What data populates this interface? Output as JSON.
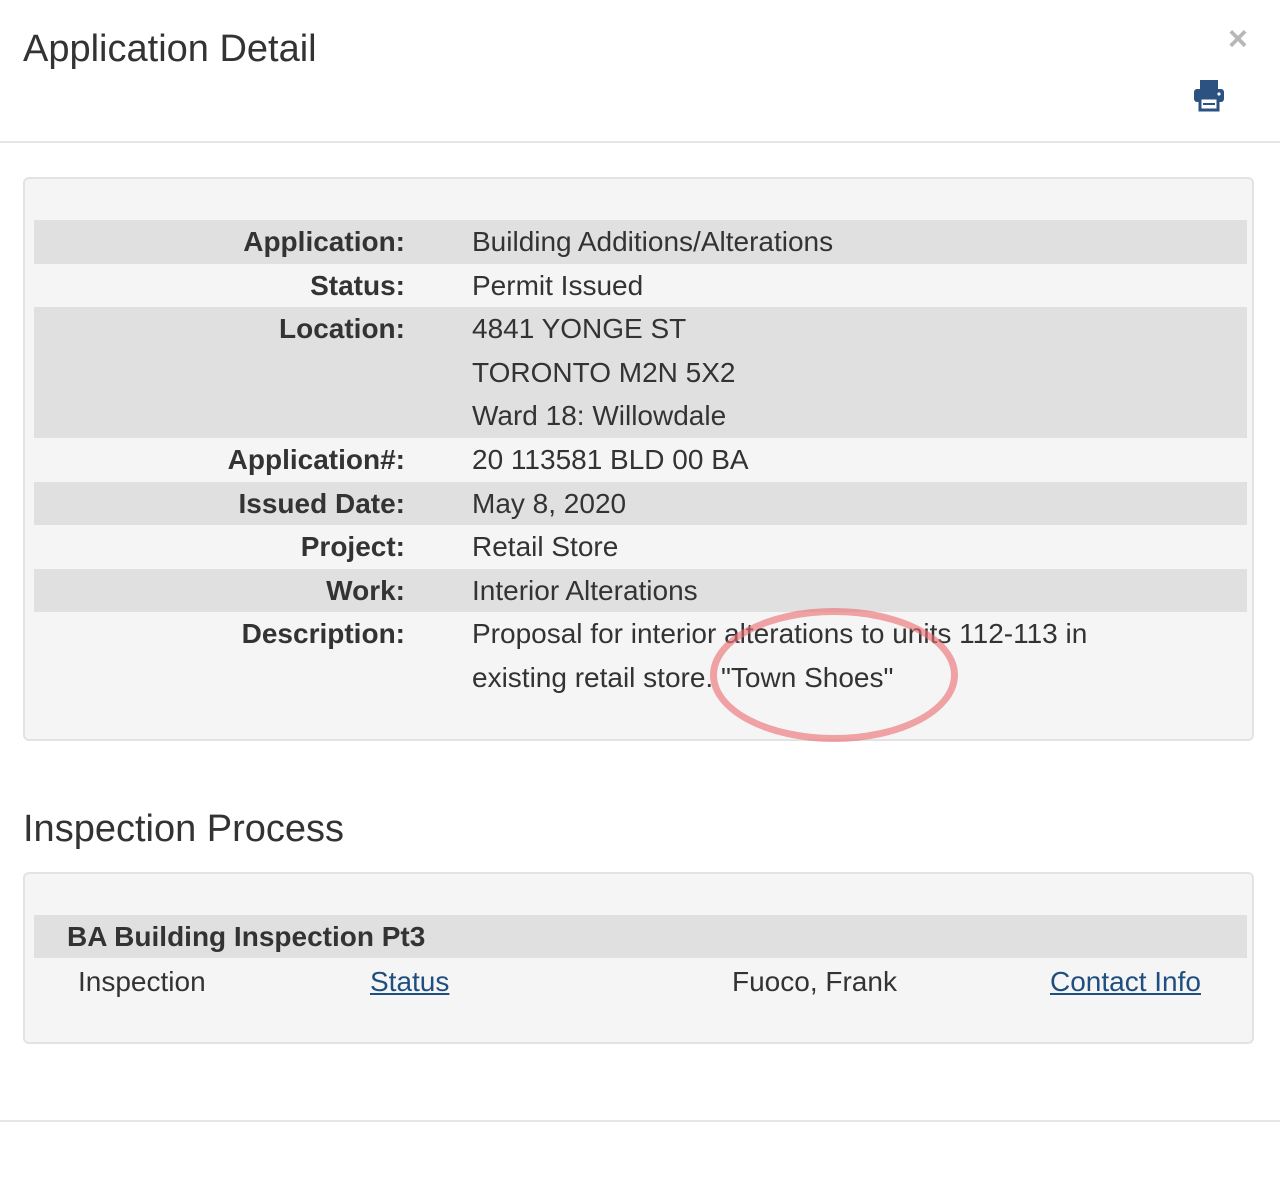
{
  "header": {
    "title": "Application Detail",
    "close_label": "×",
    "print_icon": "print-icon"
  },
  "details": {
    "rows": [
      {
        "label": "Application:",
        "lines": [
          "Building Additions/Alterations"
        ]
      },
      {
        "label": "Status:",
        "lines": [
          "Permit Issued"
        ]
      },
      {
        "label": "Location:",
        "lines": [
          "4841 YONGE ST",
          "TORONTO M2N 5X2",
          "Ward 18: Willowdale"
        ]
      },
      {
        "label": "Application#:",
        "lines": [
          "20 113581 BLD 00 BA"
        ]
      },
      {
        "label": "Issued Date:",
        "lines": [
          "May 8, 2020"
        ]
      },
      {
        "label": "Project:",
        "lines": [
          "Retail Store"
        ]
      },
      {
        "label": "Work:",
        "lines": [
          "Interior Alterations"
        ]
      },
      {
        "label": "Description:",
        "lines": [
          "Proposal for interior alterations to units 112-113 in",
          "existing retail store. \"Town Shoes\""
        ]
      }
    ]
  },
  "inspection": {
    "section_title": "Inspection Process",
    "group_title": "BA Building Inspection Pt3",
    "row": {
      "type": "Inspection",
      "status_link": "Status",
      "inspector": "Fuoco, Frank",
      "contact_link": "Contact Info"
    }
  },
  "colors": {
    "link": "#1f4e80",
    "print_icon": "#2c5282",
    "panel_bg": "#f5f5f5",
    "row_shade": "#e0e0e0",
    "annotation": "#ec6e73"
  }
}
